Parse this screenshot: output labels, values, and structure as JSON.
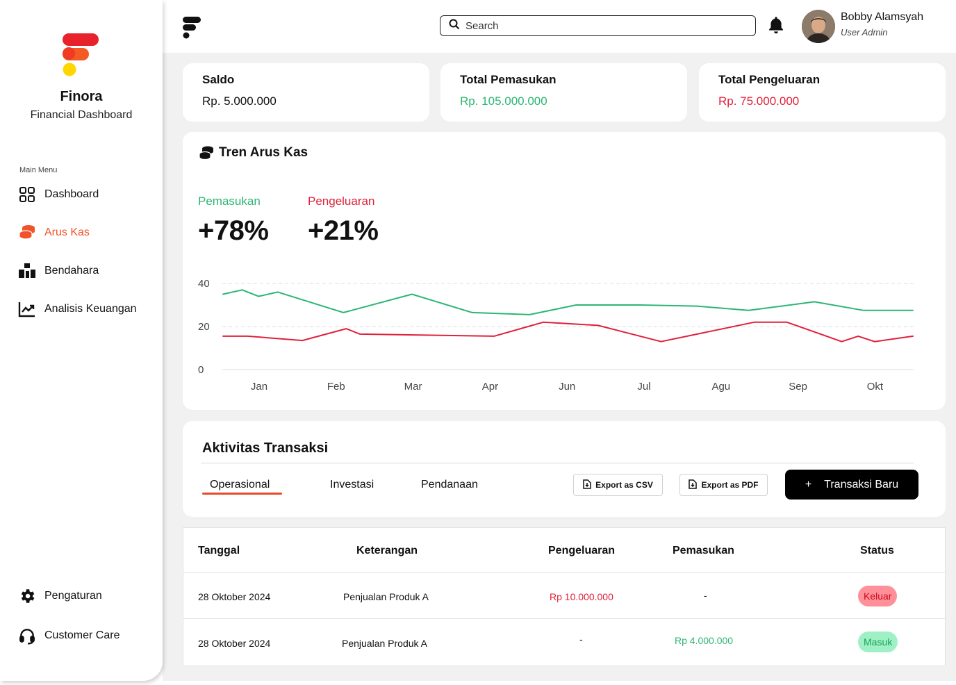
{
  "brand": {
    "name": "Finora",
    "subtitle": "Financial Dashboard"
  },
  "sidebar": {
    "caption": "Main Menu",
    "items": [
      {
        "label": "Dashboard",
        "icon": "grid-icon"
      },
      {
        "label": "Arus Kas",
        "icon": "coins-icon"
      },
      {
        "label": "Bendahara",
        "icon": "boxes-icon"
      },
      {
        "label": "Analisis Keuangan",
        "icon": "trending-chart-icon"
      }
    ],
    "active": "Arus Kas",
    "bottom": [
      {
        "label": "Pengaturan",
        "icon": "gear-icon"
      },
      {
        "label": "Customer Care",
        "icon": "headset-icon"
      }
    ]
  },
  "header": {
    "search_placeholder": "Search",
    "user": {
      "name": "Bobby Alamsyah",
      "role": "User Admin"
    }
  },
  "stats": [
    {
      "label": "Saldo",
      "value": "Rp. 5.000.000",
      "color": "#111111"
    },
    {
      "label": "Total Pemasukan",
      "value": "Rp. 105.000.000",
      "color": "#2bb673"
    },
    {
      "label": "Total Pengeluaran",
      "value": "Rp. 75.000.000",
      "color": "#e0203a"
    }
  ],
  "trend": {
    "title": "Tren Arus Kas",
    "income": {
      "label": "Pemasukan",
      "value": "+78%",
      "color": "#2bb673"
    },
    "expense": {
      "label": "Pengeluaran",
      "value": "+21%",
      "color": "#e0203a"
    }
  },
  "chart_data": {
    "type": "line",
    "x": [
      "Jan",
      "Feb",
      "Mar",
      "Apr",
      "Jun",
      "Jul",
      "Agu",
      "Sep",
      "Okt"
    ],
    "yticks": [
      0,
      20,
      40
    ],
    "ylim": [
      0,
      40
    ],
    "grid": true,
    "series": [
      {
        "color": "#2bb673",
        "points": [
          [
            0,
            35
          ],
          [
            0.35,
            37
          ],
          [
            0.65,
            34
          ],
          [
            1,
            36
          ],
          [
            2.2,
            26.5
          ],
          [
            3.45,
            35
          ],
          [
            4.55,
            26.5
          ],
          [
            5.6,
            25.5
          ],
          [
            6.45,
            30
          ],
          [
            7.6,
            30
          ],
          [
            8.65,
            29.5
          ],
          [
            9.6,
            27.5
          ],
          [
            10.8,
            31.5
          ],
          [
            11.7,
            27.5
          ],
          [
            12.6,
            27.5
          ]
        ]
      },
      {
        "color": "#e0203a",
        "points": [
          [
            0,
            15.5
          ],
          [
            0.45,
            15.5
          ],
          [
            1.45,
            13.5
          ],
          [
            2.25,
            19
          ],
          [
            2.5,
            16.5
          ],
          [
            4.95,
            15.5
          ],
          [
            5.85,
            22
          ],
          [
            6.85,
            20.5
          ],
          [
            8,
            13
          ],
          [
            9.7,
            22
          ],
          [
            10.3,
            22
          ],
          [
            11.3,
            13
          ],
          [
            11.6,
            15.5
          ],
          [
            11.9,
            13
          ],
          [
            12.6,
            15.5
          ]
        ]
      }
    ]
  },
  "transactions": {
    "title": "Aktivitas Transaksi",
    "tabs": [
      "Operasional",
      "Investasi",
      "Pendanaan"
    ],
    "active_tab": "Operasional",
    "export_csv": "Export as CSV",
    "export_pdf": "Export as PDF",
    "new_button": "Transaksi Baru",
    "plus": "+"
  },
  "table": {
    "headers": [
      "Tanggal",
      "Keterangan",
      "Pengeluaran",
      "Pemasukan",
      "Status"
    ],
    "rows": [
      {
        "date": "28 Oktober 2024",
        "desc": "Penjualan Produk A",
        "expense": "Rp 10.000.000",
        "income": "-",
        "status": "Keluar"
      },
      {
        "date": "28 Oktober 2024",
        "desc": "Penjualan Produk A",
        "expense": "-",
        "income": "Rp 4.000.000",
        "status": "Masuk"
      }
    ]
  },
  "colors": {
    "accent": "#f0532a",
    "income": "#2bb673",
    "expense": "#e0203a",
    "badge_out_bg": "#ff8f99",
    "badge_in_bg": "#9ff0c4"
  }
}
